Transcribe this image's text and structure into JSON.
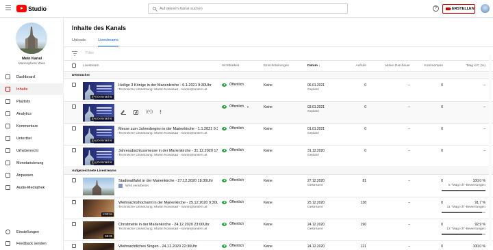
{
  "app": {
    "logo_text": "Studio",
    "search_placeholder": "Auf deinem Kanal suchen",
    "help_glyph": "?",
    "create_label": "ERSTELLEN"
  },
  "sidebar": {
    "channel_name": "Mein Kanal",
    "channel_sub": "Marienpfarre Wien",
    "items": [
      {
        "label": "Dashboard",
        "icon": "dashboard-icon"
      },
      {
        "label": "Inhalte",
        "icon": "content-icon",
        "active": true
      },
      {
        "label": "Playlists",
        "icon": "playlists-icon"
      },
      {
        "label": "Analytics",
        "icon": "analytics-icon"
      },
      {
        "label": "Kommentare",
        "icon": "comments-icon"
      },
      {
        "label": "Untertitel",
        "icon": "subtitles-icon"
      },
      {
        "label": "Urheberrecht",
        "icon": "copyright-icon"
      },
      {
        "label": "Monetarisierung",
        "icon": "monetization-icon"
      },
      {
        "label": "Anpassen",
        "icon": "customize-icon"
      },
      {
        "label": "Audio-Mediathek",
        "icon": "audio-library-icon"
      }
    ],
    "bottom_items": [
      {
        "label": "Einstellungen",
        "icon": "settings-icon"
      },
      {
        "label": "Feedback senden",
        "icon": "feedback-icon"
      }
    ]
  },
  "main": {
    "title": "Inhalte des Kanals",
    "tabs": [
      "Uploads",
      "Livestreams"
    ],
    "active_tab": "Livestreams",
    "filter_placeholder": "Filter",
    "columns": {
      "livestream": "Livestream",
      "visibility": "Sichtbarkeit",
      "restrictions": "Einschränkungen",
      "date": "Datum",
      "views": "Aufrufe",
      "active_viewers": "Aktive Zuschauer",
      "comments": "Kommentare",
      "likes": "\"Mag ich\" (%)"
    },
    "sections": [
      "Demnächst",
      "Aufgezeichnete Livestreams"
    ],
    "row_actions": {
      "edit_icon": "pencil-icon",
      "analytics_icon": "analytics-icon",
      "live_icon": "live-icon",
      "more_glyph": "⋮"
    }
  },
  "upcoming": [
    {
      "title": "Heilige 3 Könige in der Marienkirche - 6.1.2021 9:30Uhr",
      "desc": "Technische Umsetzung: Martin Nowosad - martin@lantern.at",
      "badge": "((•)) Demnächst",
      "visibility": "Öffentlich",
      "restrictions": "Keine",
      "date": "06.01.2021",
      "date_status": "Geplant",
      "views": "0",
      "active": "–",
      "comments": "0",
      "likes": "–"
    },
    {
      "title": "",
      "desc": "",
      "badge": "((•)) Demnächst",
      "visibility": "Öffentlich",
      "restrictions": "Keine",
      "date": "03.01.2021",
      "date_status": "Geplant",
      "views": "0",
      "active": "–",
      "comments": "0",
      "likes": "–",
      "hover": true
    },
    {
      "title": "Messe zum Jahresbeginn in der Marienkirche - 1.1.2021 9:3...",
      "desc": "Technische Umsetzung: Martin Nowosad - martin@lantern.at",
      "badge": "((•)) Demnächst",
      "visibility": "Öffentlich",
      "restrictions": "Keine",
      "date": "01.01.2021",
      "date_status": "Geplant",
      "views": "0",
      "active": "–",
      "comments": "0",
      "likes": "–"
    },
    {
      "title": "Jahresabschlussmesse in der Marienkirche - 31.12.2020 17...",
      "desc": "Technische Umsetzung: Martin Nowosad - martin@lantern.at",
      "badge": "((•)) Demnächst",
      "visibility": "Öffentlich",
      "restrictions": "Keine",
      "date": "31.12.2020",
      "date_status": "Geplant",
      "views": "0",
      "active": "–",
      "comments": "0",
      "likes": "–"
    }
  ],
  "recorded": [
    {
      "title": "Stadtwallfahrt in der Marienkirche - 27.12.2020 18:30Uhr",
      "desc": "Wird verarbeitet",
      "processing": true,
      "badge": "",
      "visibility": "Öffentlich",
      "restrictions": "Keine",
      "date": "27.12.2020",
      "date_status": "Gestreamt",
      "views": "81",
      "active": "–",
      "comments": "0",
      "likes": "100,0 %",
      "likes_sub": "5 \"Mag ich\"-Bewertungen",
      "like_fraction": 1.0,
      "thumb": "sky"
    },
    {
      "title": "Weihnachtshochamt in der Marienkirche - 25.12.2020 9:30Uhr",
      "desc": "Technische Umsetzung: Martin Nowosad - martin@lantern.at",
      "badge": "1:03:34",
      "visibility": "Öffentlich",
      "restrictions": "Keine",
      "date": "25.12.2020",
      "date_status": "Gestreamt",
      "views": "138",
      "active": "–",
      "comments": "0",
      "likes": "91,7 %",
      "likes_sub": "11 \"Mag ich\"-Bewertungen",
      "like_fraction": 0.917,
      "thumb": "warm"
    },
    {
      "title": "Christmette in der Marienkirche - 24.12.2020 23:00Uhr",
      "desc": "Technische Umsetzung: Martin Nowosad - martin@lantern.at",
      "badge": "58:36",
      "visibility": "Öffentlich",
      "restrictions": "Keine",
      "date": "24.12.2020",
      "date_status": "Gestreamt",
      "views": "190",
      "active": "–",
      "comments": "0",
      "likes": "92,9 %",
      "likes_sub": "13 \"Mag ich\"-Bewertungen",
      "like_fraction": 0.929,
      "thumb": "warm2"
    },
    {
      "title": "Weihnachtliches Singen - 24.12.2020 22:30Uhr",
      "desc": "",
      "badge": "",
      "visibility": "Öffentlich",
      "restrictions": "Keine",
      "date": "24.12.2020",
      "date_status": "",
      "views": "121",
      "active": "–",
      "comments": "0",
      "likes": "100,0 %",
      "likes_sub": "",
      "like_fraction": 1.0,
      "thumb": "warm2"
    }
  ]
}
